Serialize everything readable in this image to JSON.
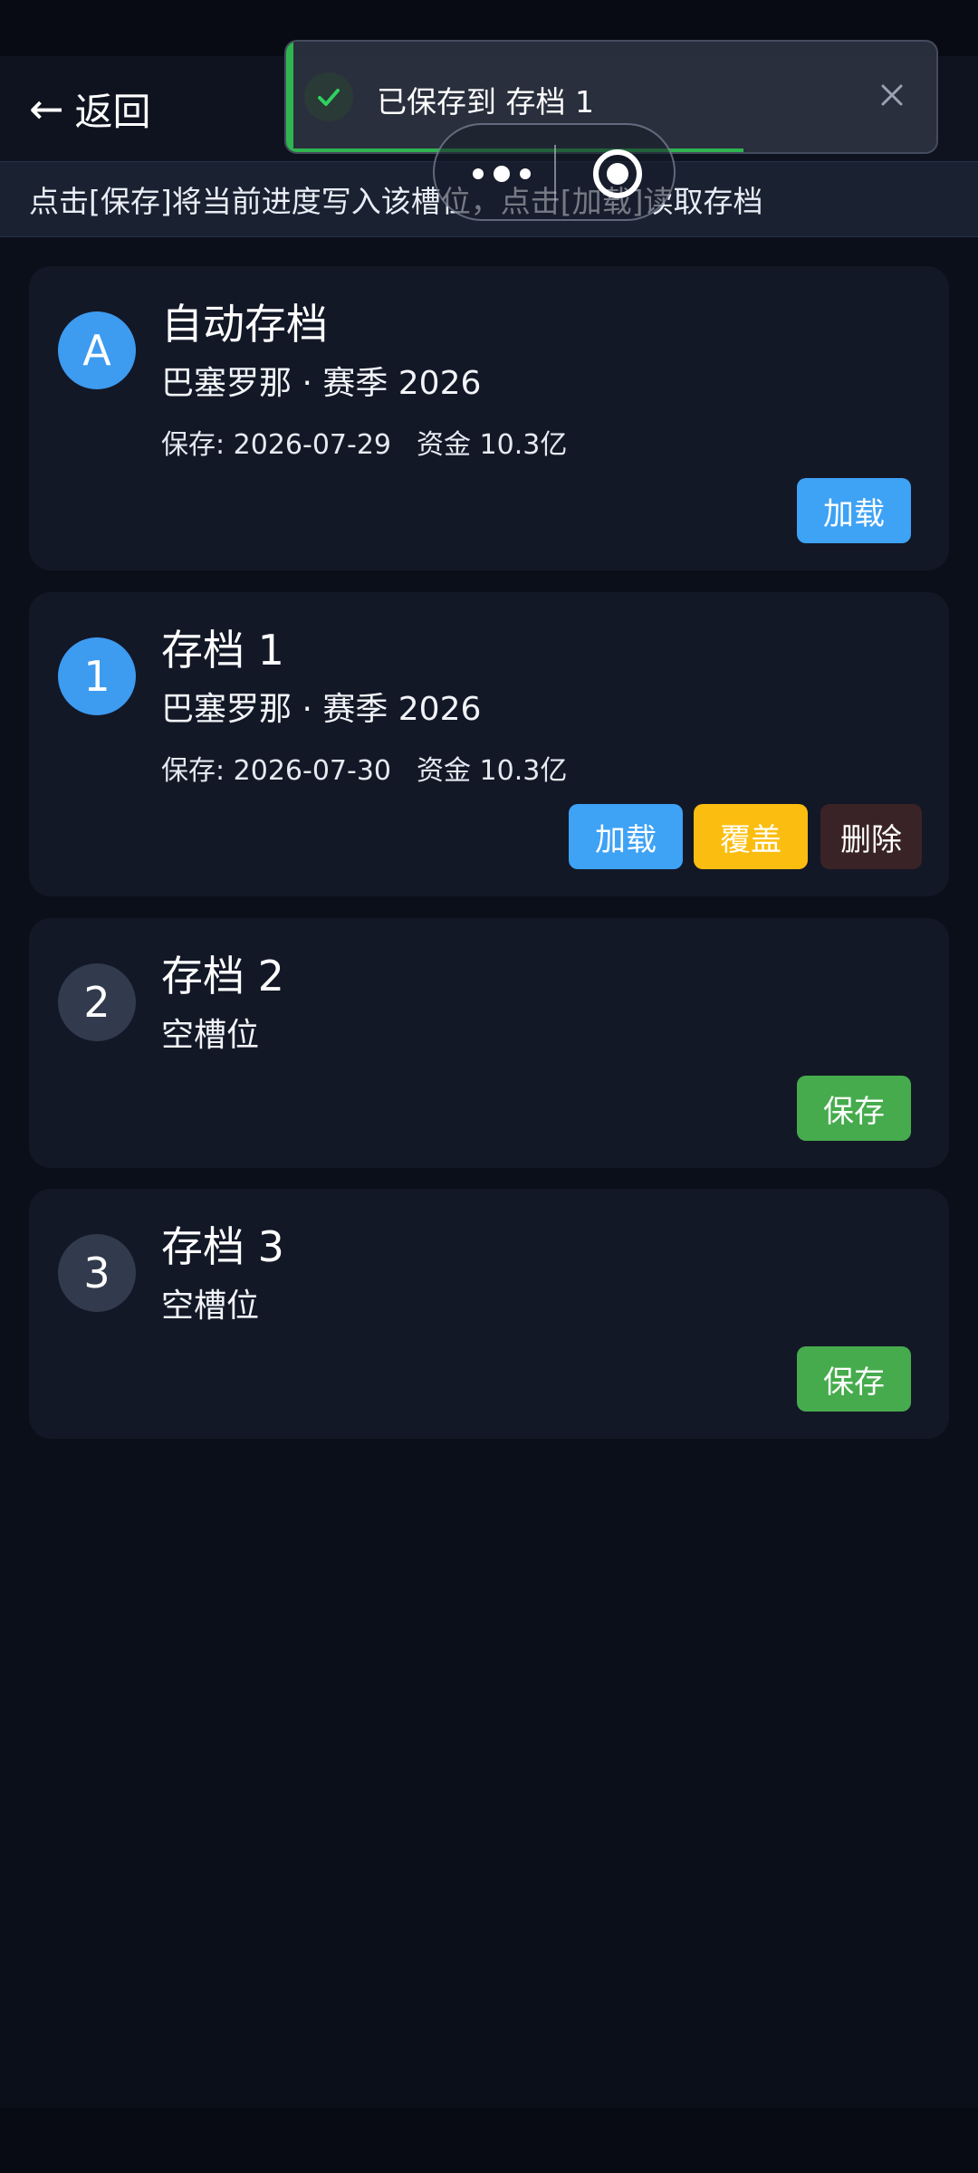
{
  "header": {
    "back_arrow": "←",
    "back_label": "返回"
  },
  "hint": "点击[保存]将当前进度写入该槽位，点击[加载]读取存档",
  "slots": [
    {
      "badge": "A",
      "title": "自动存档",
      "subtitle": "巴塞罗那 · 赛季 2026",
      "saved": "保存: 2026-07-29",
      "funds": "资金 10.3亿",
      "buttons": [
        "加载"
      ]
    },
    {
      "badge": "1",
      "title": "存档 1",
      "subtitle": "巴塞罗那 · 赛季 2026",
      "saved": "保存: 2026-07-30",
      "funds": "资金 10.3亿",
      "buttons": [
        "加载",
        "覆盖",
        "删除"
      ]
    },
    {
      "badge": "2",
      "title": "存档 2",
      "subtitle": "空槽位",
      "buttons": [
        "保存"
      ]
    },
    {
      "badge": "3",
      "title": "存档 3",
      "subtitle": "空槽位",
      "buttons": [
        "保存"
      ]
    }
  ],
  "toast": {
    "message": "已保存到 存档 1",
    "progress_fraction": 0.7
  },
  "colors": {
    "background": "#0b0f19",
    "card": "#131827",
    "accent_blue": "#3ea2f5",
    "warn_yellow": "#fbbd0f",
    "danger_dark": "#3a2326",
    "success_green": "#46ab4c"
  },
  "icons": {
    "toast": "check-circle-icon",
    "close": "close-icon",
    "back": "back-arrow-icon",
    "capsule_more": "more-dots-icon",
    "capsule_target": "target-circle-icon"
  }
}
